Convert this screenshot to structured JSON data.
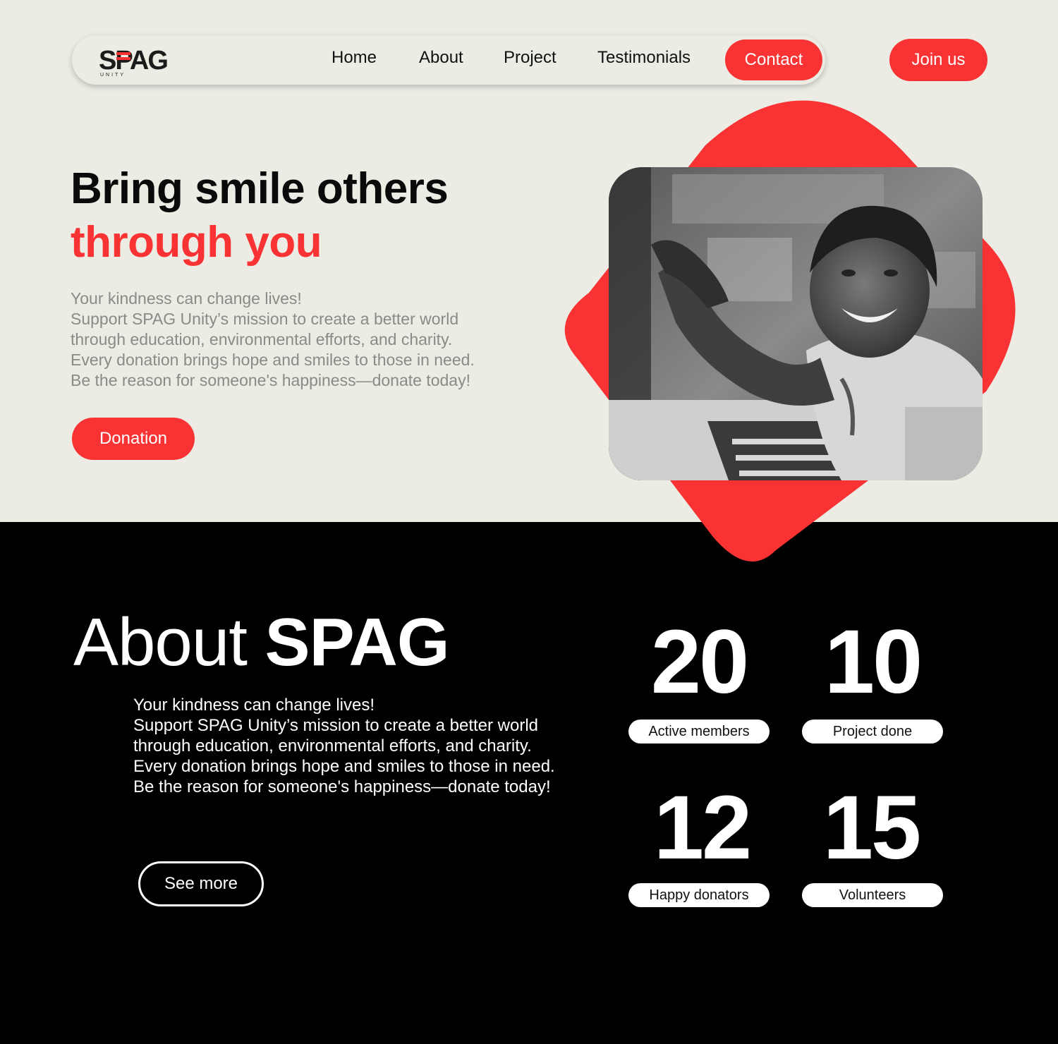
{
  "nav": {
    "logo_text": "SPAG",
    "logo_sub": "UNITY",
    "links": [
      "Home",
      "About",
      "Project",
      "Testimonials"
    ],
    "contact_label": "Contact",
    "join_label": "Join us"
  },
  "hero": {
    "title_line1": "Bring smile others",
    "title_line2": "through you",
    "body": [
      "Your kindness can change lives!",
      "Support SPAG Unity’s mission to create a better world",
      "through education, environmental efforts, and charity.",
      "Every donation brings hope and smiles to those in need.",
      "Be the reason for someone's happiness—donate today!"
    ],
    "donation_label": "Donation"
  },
  "about": {
    "title_light": "About ",
    "title_bold": "SPAG",
    "body": [
      "Your kindness can change lives!",
      "Support SPAG Unity’s mission to create a better world",
      "through education, environmental efforts, and charity.",
      "Every donation brings hope and smiles to those in need.",
      "Be the reason for someone's happiness—donate today!"
    ],
    "see_more_label": "See more",
    "stats": [
      {
        "value": "20",
        "label": "Active members"
      },
      {
        "value": "10",
        "label": "Project done"
      },
      {
        "value": "12",
        "label": "Happy donators"
      },
      {
        "value": "15",
        "label": "Volunteers"
      }
    ]
  },
  "colors": {
    "accent": "#f93233",
    "hero_bg": "#ecebe4",
    "dark_bg": "#000000"
  }
}
